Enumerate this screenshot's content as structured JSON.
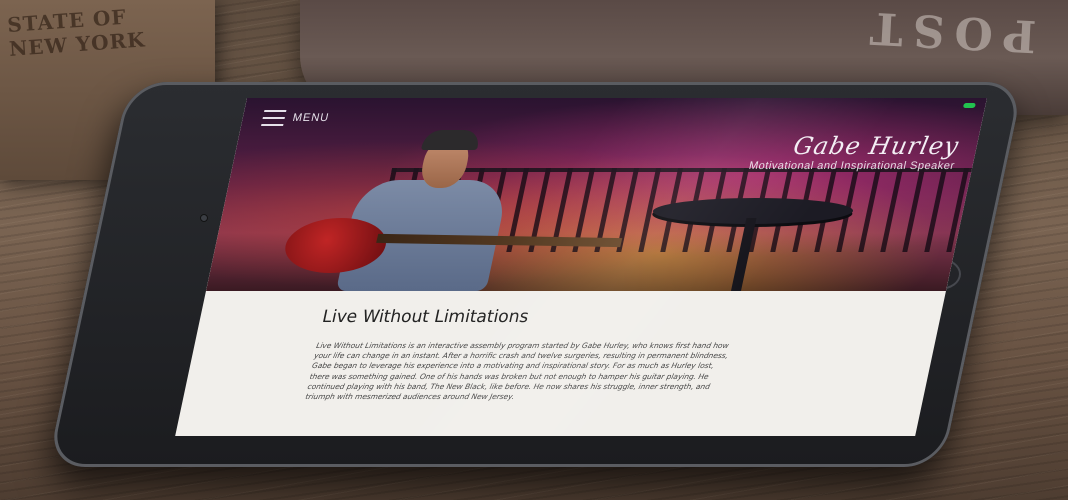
{
  "background": {
    "crate_text": "STATE OF\nNEW YORK",
    "sack_text": "RTG POST"
  },
  "site": {
    "menu_label": "MENU",
    "name": "Gabe Hurley",
    "tagline": "Motivational and Inspirational Speaker",
    "accent_color": "#22c34f"
  },
  "main": {
    "heading": "Live Without Limitations",
    "paragraph": "Live Without Limitations is an interactive assembly program started by Gabe Hurley, who knows first hand how your life can change in an instant. After a horrific crash and twelve surgeries, resulting in permanent blindness, Gabe began to leverage his experience into a motivating and inspirational story. For as much as Hurley lost, there was something gained. One of his hands was broken but not enough to hamper his guitar playing. He continued playing with his band, The New Black, like before. He now shares his struggle, inner strength, and triumph with mesmerized audiences around New Jersey."
  },
  "icons": [
    "hamburger-icon",
    "camera-icon",
    "home-button-icon"
  ]
}
